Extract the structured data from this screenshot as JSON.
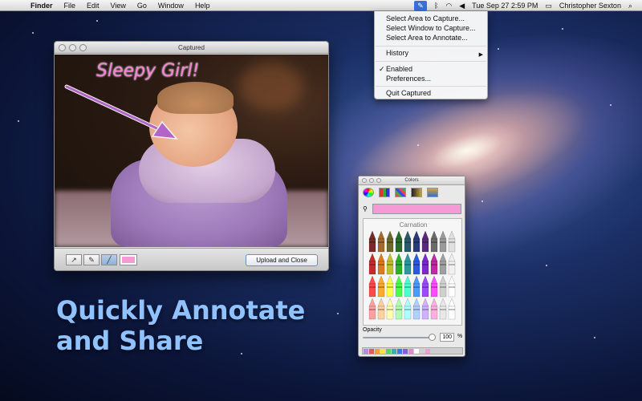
{
  "menubar": {
    "app": "Finder",
    "menus": [
      "File",
      "Edit",
      "View",
      "Go",
      "Window",
      "Help"
    ],
    "clock": "Tue Sep 27  2:59 PM",
    "user": "Christopher Sexton"
  },
  "dropdown": {
    "items": [
      "Select Area to Capture...",
      "Select Window to Capture...",
      "Select Area to Annotate...",
      "History",
      "Enabled",
      "Preferences...",
      "Quit Captured"
    ],
    "checked_item": "Enabled",
    "submenu_arrow": "▶"
  },
  "capture_window": {
    "title": "Captured",
    "annotation_text": "Sleepy Girl!",
    "upload_label": "Upload and Close",
    "tools": [
      "arrow-tool",
      "pen-tool",
      "highlighter-tool"
    ],
    "selected_tool": "highlighter-tool",
    "selected_color": "#f59ad4"
  },
  "colors_panel": {
    "title": "Colors",
    "crayon_name": "Carnation",
    "opacity_label": "Opacity",
    "opacity_value": "100",
    "opacity_unit": "%",
    "selected_color": "#f59ad4",
    "swatches": [
      "#b48be0",
      "#e05a5a",
      "#f2a23a",
      "#f7e04a",
      "#5bd35b",
      "#3bb0a0",
      "#3a7ae0",
      "#8c5ae0",
      "#e08ad0",
      "#ffffff",
      "#cfcfcf",
      "#f59ad4"
    ],
    "crayon_colors": [
      [
        "#7a2a2a",
        "#a56a2a",
        "#6a6a2a",
        "#2a6a2a",
        "#2a5a6a",
        "#2a3a7a",
        "#5a2a7a",
        "#6a6a6a",
        "#9a9a9a",
        "#e0e0e0"
      ],
      [
        "#c82a2a",
        "#e07a1a",
        "#c0c02a",
        "#2ab02a",
        "#2a9aa0",
        "#2a5ae0",
        "#7a2ad0",
        "#c02aa0",
        "#a0a0a0",
        "#f0f0f0"
      ],
      [
        "#ff4a4a",
        "#ffaa2a",
        "#ffff4a",
        "#4aff4a",
        "#4affd0",
        "#4a9aff",
        "#9a4aff",
        "#ff4aff",
        "#d0d0d0",
        "#ffffff"
      ],
      [
        "#ffa0a0",
        "#ffd0a0",
        "#ffffb0",
        "#b0ffb0",
        "#b0ffff",
        "#b0d0ff",
        "#d0b0ff",
        "#ffb0e0",
        "#e8e8e8",
        "#ffffff"
      ]
    ]
  },
  "headline": {
    "line1": "Quickly Annotate",
    "line2": "and Share"
  }
}
